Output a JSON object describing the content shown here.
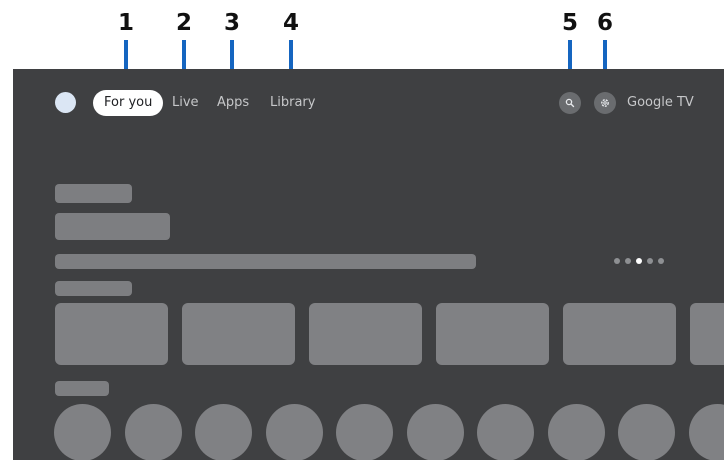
{
  "callouts": [
    "1",
    "2",
    "3",
    "4",
    "5",
    "6"
  ],
  "nav": {
    "tabs": [
      {
        "label": "For you",
        "active": true
      },
      {
        "label": "Live",
        "active": false
      },
      {
        "label": "Apps",
        "active": false
      },
      {
        "label": "Library",
        "active": false
      }
    ],
    "search_icon": "search-icon",
    "settings_icon": "gear-icon",
    "brand": "Google TV"
  },
  "hero": {
    "pager": {
      "total": 5,
      "active_index": 2
    }
  },
  "colors": {
    "screen_bg": "#3f4042",
    "placeholder": "#7d7e81",
    "callout_line": "#1565c0",
    "active_tab_bg": "#ffffff"
  }
}
